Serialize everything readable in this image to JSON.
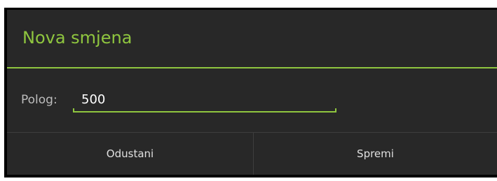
{
  "dialog": {
    "title": "Nova smjena",
    "field": {
      "label": "Polog:",
      "value": "500"
    },
    "buttons": {
      "cancel_label": "Odustani",
      "save_label": "Spremi"
    }
  },
  "colors": {
    "accent": "#8fc63f",
    "background": "#282828",
    "text": "#ffffff",
    "label": "#bdbdbd"
  }
}
